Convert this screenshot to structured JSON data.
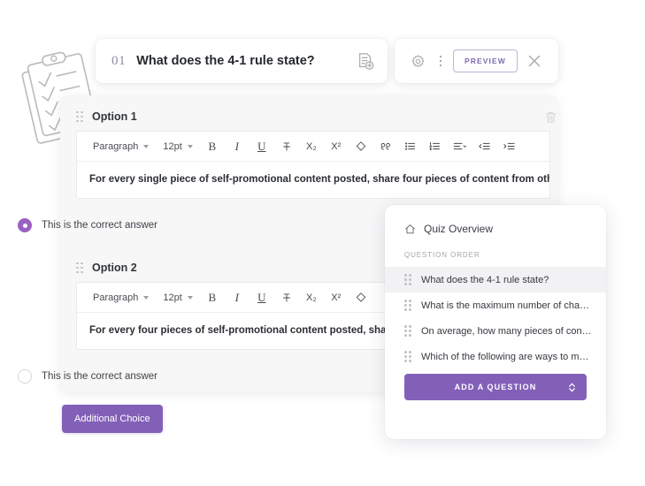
{
  "header": {
    "question_number": "01",
    "question_title": "What does the 4-1 rule state?",
    "add_doc_icon": "document-add-icon"
  },
  "toolbar": {
    "settings_icon": "gear-icon",
    "more_icon": "kebab-menu-icon",
    "preview_label": "PREVIEW",
    "close_icon": "close-icon"
  },
  "options": [
    {
      "label": "Option 1",
      "drag_icon": "drag-handle-icon",
      "delete_icon": "trash-icon",
      "format": {
        "block": "Paragraph",
        "size": "12pt",
        "bold": "B",
        "italic": "I",
        "underline": "U",
        "strikethrough": "S",
        "subscript": "X₂",
        "superscript": "X²",
        "clear": "eraser-icon",
        "quote": "quote-icon",
        "bullet_list": "bullet-list-icon",
        "numbered_list": "numbered-list-icon",
        "align": "align-icon",
        "outdent": "outdent-icon",
        "indent": "indent-icon"
      },
      "body": "For every single piece of self-promotional content posted, share four pieces of content from others.",
      "answer_label": "This is the correct answer",
      "is_correct": true
    },
    {
      "label": "Option 2",
      "drag_icon": "drag-handle-icon",
      "format": {
        "block": "Paragraph",
        "size": "12pt",
        "bold": "B",
        "italic": "I",
        "underline": "U",
        "strikethrough": "S",
        "subscript": "X₂",
        "superscript": "X²",
        "clear": "eraser-icon"
      },
      "body": "For every four pieces of self-promotional content posted, share one",
      "answer_label": "This is the correct answer",
      "is_correct": false
    }
  ],
  "additional_choice_label": "Additional Choice",
  "overview": {
    "home_icon": "home-icon",
    "title": "Quiz Overview",
    "section_label": "QUESTION ORDER",
    "questions": [
      "What does the 4-1 rule state?",
      "What is the maximum number of chara...",
      "On average, how many pieces of conte...",
      "Which of the following are ways to me..."
    ],
    "add_question_label": "ADD A QUESTION",
    "add_question_caret": "sort-caret-icon"
  },
  "colors": {
    "accent_purple": "#8360b8",
    "radio_purple": "#9a61c4",
    "preview_text": "#7c6bb0",
    "panel_bg": "#f7f7f8"
  },
  "decoration": {
    "clipboard_icon": "clipboard-checklist-illustration"
  }
}
